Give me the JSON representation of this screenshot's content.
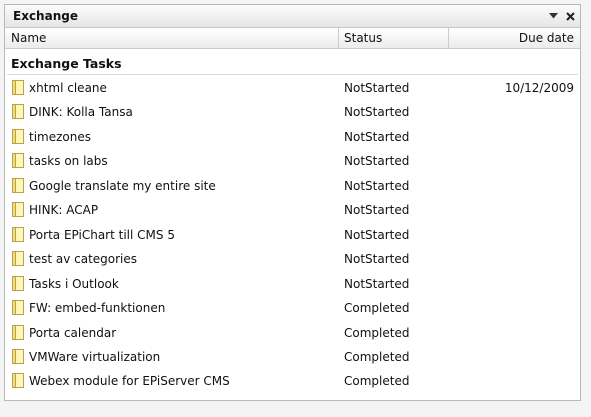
{
  "window": {
    "title": "Exchange"
  },
  "columns": {
    "name": "Name",
    "status": "Status",
    "due": "Due date"
  },
  "group": {
    "label": "Exchange Tasks"
  },
  "tasks": [
    {
      "name": "xhtml cleane",
      "status": "NotStarted",
      "due": "10/12/2009"
    },
    {
      "name": "DINK: Kolla Tansa",
      "status": "NotStarted",
      "due": ""
    },
    {
      "name": "timezones",
      "status": "NotStarted",
      "due": ""
    },
    {
      "name": "tasks on labs",
      "status": "NotStarted",
      "due": ""
    },
    {
      "name": "Google translate my entire site",
      "status": "NotStarted",
      "due": ""
    },
    {
      "name": "HINK: ACAP",
      "status": "NotStarted",
      "due": ""
    },
    {
      "name": "Porta EPiChart till CMS 5",
      "status": "NotStarted",
      "due": ""
    },
    {
      "name": "test av categories",
      "status": "NotStarted",
      "due": ""
    },
    {
      "name": "Tasks i Outlook",
      "status": "NotStarted",
      "due": ""
    },
    {
      "name": "FW: embed-funktionen",
      "status": "Completed",
      "due": ""
    },
    {
      "name": "Porta calendar",
      "status": "Completed",
      "due": ""
    },
    {
      "name": "VMWare virtualization",
      "status": "Completed",
      "due": ""
    },
    {
      "name": "Webex module for EPiServer CMS",
      "status": "Completed",
      "due": ""
    }
  ]
}
